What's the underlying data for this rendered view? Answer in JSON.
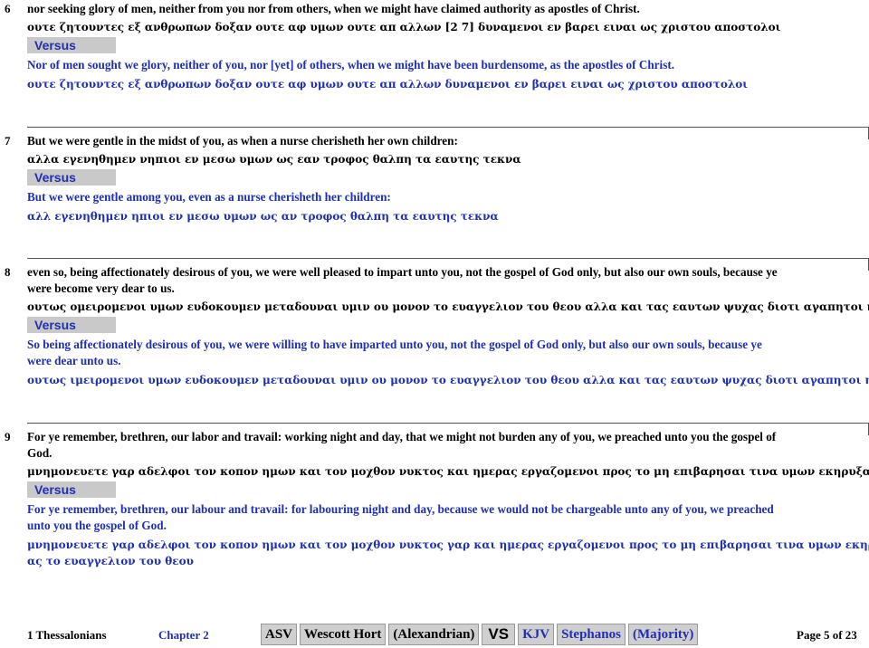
{
  "verses": [
    {
      "num": "6",
      "kjv": "nor seeking glory of men, neither from you nor from others, when we might have claimed authority as apostles of Christ.",
      "greek1": "ουτε ζητουντες εξ ανθρωπων δοξαν ουτε αφ υμων ουτε απ αλλων [2 7] δυναμενοι εν βαρει ειναι ως χριστου αποστολοι",
      "versus": "Versus",
      "kjv2": "Nor of men sought we glory, neither of you, nor [yet] of others, when we might have been burdensome, as the apostles of Christ.",
      "greek2": "ουτε ζητουντες εξ ανθρωπων δοξαν ουτε αφ υμων ουτε απ αλλων δυναμενοι εν βαρει ειναι ως χριστου αποστολοι"
    },
    {
      "num": "7",
      "kjv": "But we were gentle in the midst of you, as when a nurse cherisheth her own children:",
      "greek1": "αλλα εγενηθημεν νηπιοι εν μεσω υμων ως εαν τροφος θαλπη τα εαυτης τεκνα",
      "versus": "Versus",
      "kjv2": "But we were gentle among you, even as a nurse cherisheth her children:",
      "greek2": "αλλ εγενηθημεν ηπιοι εν μεσω υμων ως αν τροφος θαλπη τα εαυτης τεκνα"
    },
    {
      "num": "8",
      "kjv_a": "even so, being affectionately desirous of you, we were well pleased to impart unto you, not the gospel of God only, but also our own souls, because ye",
      "kjv_b": "were become very dear to us.",
      "greek1": "ουτως ομειρομενοι υμων ευδοκουμεν μεταδουναι υμιν ου μονον το ευαγγελιον του θεου αλλα και τας εαυτων ψυχας διοτι αγαπητοι ημιν εγενηθητε",
      "versus": "Versus",
      "kjv2_a": "So being affectionately desirous of you, we were willing to have imparted unto you, not the gospel of God only, but also our own souls, because ye",
      "kjv2_b": "were dear unto us.",
      "greek2": "ουτως ιμειρομενοι υμων ευδοκουμεν μεταδουναι υμιν ου μονον το ευαγγελιον του θεου αλλα και τας εαυτων ψυχας διοτι αγαπητοι ημιν γεγενησθε"
    },
    {
      "num": "9",
      "kjv_a": "For ye remember, brethren, our labor and travail: working night and day, that we might not burden any of you, we preached unto you the gospel of",
      "kjv_b": "God.",
      "greek1": "μνημονευετε γαρ αδελφοι τον κοπον ημων και τον μοχθον νυκτος και ημερας εργαζομενοι προς το μη επιβαρησαι τινα υμων εκηρυξαμεν εις υμας τ",
      "versus": "Versus",
      "kjv2_a": "For ye remember, brethren, our labour and travail: for labouring night and day, because we would not be chargeable unto any of you, we preached",
      "kjv2_b": "unto you the gospel of God.",
      "greek2_a": "μνημονευετε γαρ αδελφοι τον κοπον ημων και τον μοχθον νυκτος γαρ και ημερας εργαζομενοι προς το μη επιβαρησαι τινα υμων εκηρυξαμεν εις υμ",
      "greek2_b": "ας το ευαγγελιον του θεου"
    }
  ],
  "footer": {
    "book": "1 Thessalonians",
    "chapter": "Chapter  2",
    "buttons_left": [
      "ASV",
      "Wescott  Hort",
      "(Alexandrian)"
    ],
    "vs": "VS",
    "buttons_right": [
      "KJV",
      "Stephanos",
      "(Majority)"
    ],
    "page": "Page 5 of 23"
  },
  "colors": {
    "blue_text": "#1f2fb4",
    "versus_bg": "#c9c9c9"
  }
}
